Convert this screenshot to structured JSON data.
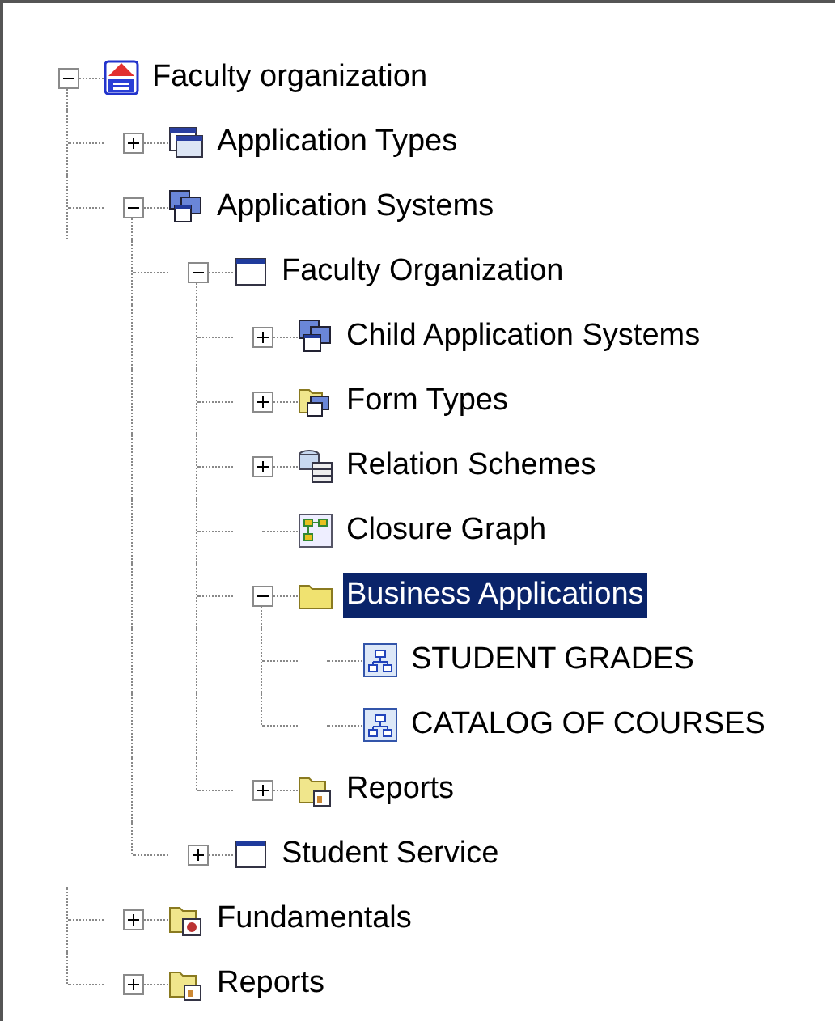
{
  "tree": [
    {
      "label": "Faculty organization",
      "kind": "logo",
      "expanded": true,
      "selected": false,
      "children": [
        {
          "label": "Application Types",
          "kind": "window-types",
          "expanded": false,
          "selected": false
        },
        {
          "label": "Application Systems",
          "kind": "windows",
          "expanded": true,
          "selected": false,
          "children": [
            {
              "label": "Faculty Organization",
              "kind": "window",
              "expanded": true,
              "selected": false,
              "children": [
                {
                  "label": "Child Application Systems",
                  "kind": "windows",
                  "expanded": false,
                  "selected": false
                },
                {
                  "label": "Form Types",
                  "kind": "folder-windows",
                  "expanded": false,
                  "selected": false
                },
                {
                  "label": "Relation Schemes",
                  "kind": "database",
                  "expanded": false,
                  "selected": false
                },
                {
                  "label": "Closure Graph",
                  "kind": "graph",
                  "selected": false
                },
                {
                  "label": "Business Applications",
                  "kind": "folder",
                  "expanded": true,
                  "selected": true,
                  "children": [
                    {
                      "label": "STUDENT GRADES",
                      "kind": "diagram",
                      "selected": false
                    },
                    {
                      "label": "CATALOG OF COURSES",
                      "kind": "diagram",
                      "selected": false
                    }
                  ]
                },
                {
                  "label": "Reports",
                  "kind": "folder-report",
                  "expanded": false,
                  "selected": false
                }
              ]
            },
            {
              "label": "Student Service",
              "kind": "window",
              "expanded": false,
              "selected": false
            }
          ]
        },
        {
          "label": "Fundamentals",
          "kind": "folder-fundamentals",
          "expanded": false,
          "selected": false
        },
        {
          "label": "Reports",
          "kind": "folder-report",
          "expanded": false,
          "selected": false
        }
      ]
    }
  ]
}
